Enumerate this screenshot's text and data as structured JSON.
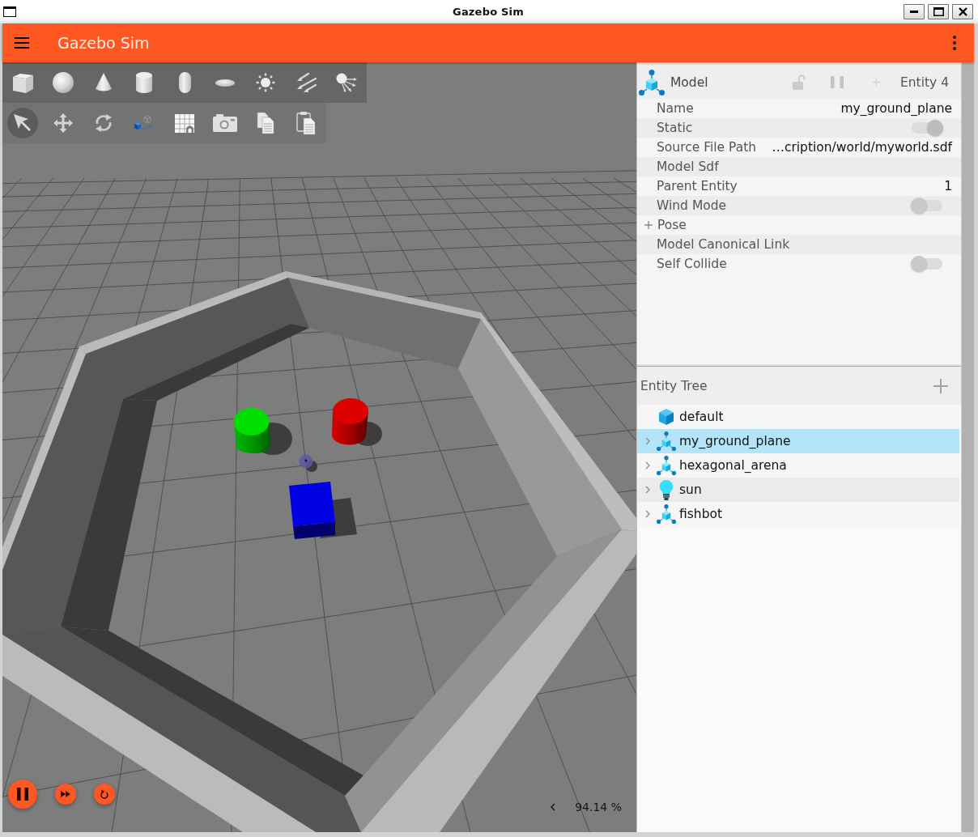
{
  "window": {
    "title": "Gazebo Sim"
  },
  "app_bar": {
    "title": "Gazebo Sim"
  },
  "toolbar": {
    "shapes": [
      {
        "kind": "box",
        "selected": false
      },
      {
        "kind": "sphere",
        "selected": false
      },
      {
        "kind": "cone",
        "selected": false
      },
      {
        "kind": "cylinder",
        "selected": false
      },
      {
        "kind": "capsule",
        "selected": false
      },
      {
        "kind": "ellipsoid",
        "selected": false
      },
      {
        "kind": "point_light",
        "selected": false
      },
      {
        "kind": "directional_light",
        "selected": false
      },
      {
        "kind": "spot_light",
        "selected": false
      }
    ],
    "tools": [
      {
        "kind": "select",
        "selected": true
      },
      {
        "kind": "translate",
        "selected": false
      },
      {
        "kind": "rotate",
        "selected": false
      },
      {
        "kind": "transform_control",
        "selected": false
      },
      {
        "kind": "grid",
        "selected": false
      },
      {
        "kind": "screenshot",
        "selected": false
      },
      {
        "kind": "copy",
        "selected": false
      },
      {
        "kind": "paste",
        "selected": false
      }
    ]
  },
  "playback": {
    "playing": true,
    "real_time_factor": "94.14 %"
  },
  "component_inspector": {
    "type": "Model",
    "entity": "Entity 4",
    "locked": false,
    "properties": [
      {
        "label": "Name",
        "kind": "text",
        "value": "my_ground_plane"
      },
      {
        "label": "Static",
        "kind": "toggle",
        "on": true
      },
      {
        "label": "Source File Path",
        "kind": "text",
        "value": "…cription/world/myworld.sdf"
      },
      {
        "label": "Model Sdf",
        "kind": "label"
      },
      {
        "label": "Parent Entity",
        "kind": "text",
        "value": "1"
      },
      {
        "label": "Wind Mode",
        "kind": "toggle",
        "on": false
      },
      {
        "label": "Pose",
        "kind": "group",
        "expanded": false
      },
      {
        "label": "Model Canonical Link",
        "kind": "label"
      },
      {
        "label": "Self Collide",
        "kind": "toggle",
        "on": false
      }
    ]
  },
  "entity_tree": {
    "title": "Entity Tree",
    "items": [
      {
        "name": "default",
        "kind": "world",
        "expandable": false,
        "selected": false
      },
      {
        "name": "my_ground_plane",
        "kind": "model",
        "expandable": true,
        "selected": true
      },
      {
        "name": "hexagonal_arena",
        "kind": "model",
        "expandable": true,
        "selected": false
      },
      {
        "name": "sun",
        "kind": "light",
        "expandable": true,
        "selected": false
      },
      {
        "name": "fishbot",
        "kind": "model",
        "expandable": true,
        "selected": false
      }
    ]
  }
}
